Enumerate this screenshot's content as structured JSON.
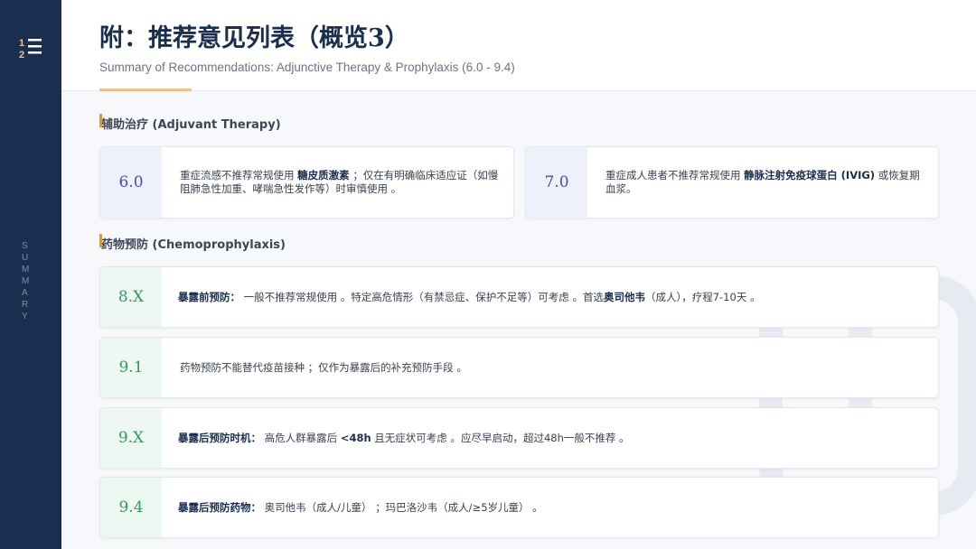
{
  "sidebar": {
    "vertical_label": [
      "S",
      "U",
      "M",
      "M",
      "A",
      "R",
      "Y"
    ]
  },
  "header": {
    "title": "附：推荐意见列表（概览3）",
    "subtitle": "Summary of Recommendations: Adjunctive Therapy & Prophylaxis (6.0 - 9.4)"
  },
  "sections": {
    "adjuvant": {
      "title": "辅助治疗 (Adjuvant Therapy)"
    },
    "prophylaxis": {
      "title": "药物预防 (Chemoprophylaxis)"
    }
  },
  "recommendations": {
    "r60": {
      "id": "6.0",
      "t1": "重症流感不推荐常规使用",
      "b1": "糖皮质激素",
      "t2": "；仅在有明确临床适应证（如慢阻肺急性加重、哮喘急性发作等）时审慎使用",
      "t3": "。"
    },
    "r70": {
      "id": "7.0",
      "t1": "重症成人患者不推荐常规使用",
      "b1": "静脉注射免疫球蛋白 (IVIG)",
      "t2": "或恢复期血浆。"
    },
    "r8x": {
      "id": "8.X",
      "b1": "暴露前预防：",
      "t1": "一般不推荐常规使用",
      "t2": "。特定高危情形（有禁忌症、保护不足等）可考虑",
      "t3": "。首选",
      "b2": "奥司他韦",
      "t4": "（成人），疗程7-10天",
      "t5": "。"
    },
    "r91": {
      "id": "9.1",
      "t1": "药物预防不能替代疫苗接种",
      "t2": "；仅作为暴露后的补充预防手段",
      "t3": "。"
    },
    "r9x": {
      "id": "9.X",
      "b1": "暴露后预防时机：",
      "t1": "高危人群暴露后",
      "b2": "<48h",
      "t2": "且无症状可考虑",
      "t3": "。应尽早启动，超过48h一般不推荐",
      "t4": "。"
    },
    "r94": {
      "id": "9.4",
      "b1": "暴露后预防药物：",
      "t1": "奥司他韦（成人/儿童）",
      "t2": "；玛巴洛沙韦（成人/≥5岁儿童）",
      "t3": "。"
    }
  },
  "colors": {
    "sidebar": "#1a2e4f",
    "accent": "#e8c48f",
    "blue_badge": "#4a4bb0",
    "green_badge": "#2f9a66"
  },
  "icons": [
    "numbered-list-icon",
    "medical-cross-watermark-icon"
  ]
}
